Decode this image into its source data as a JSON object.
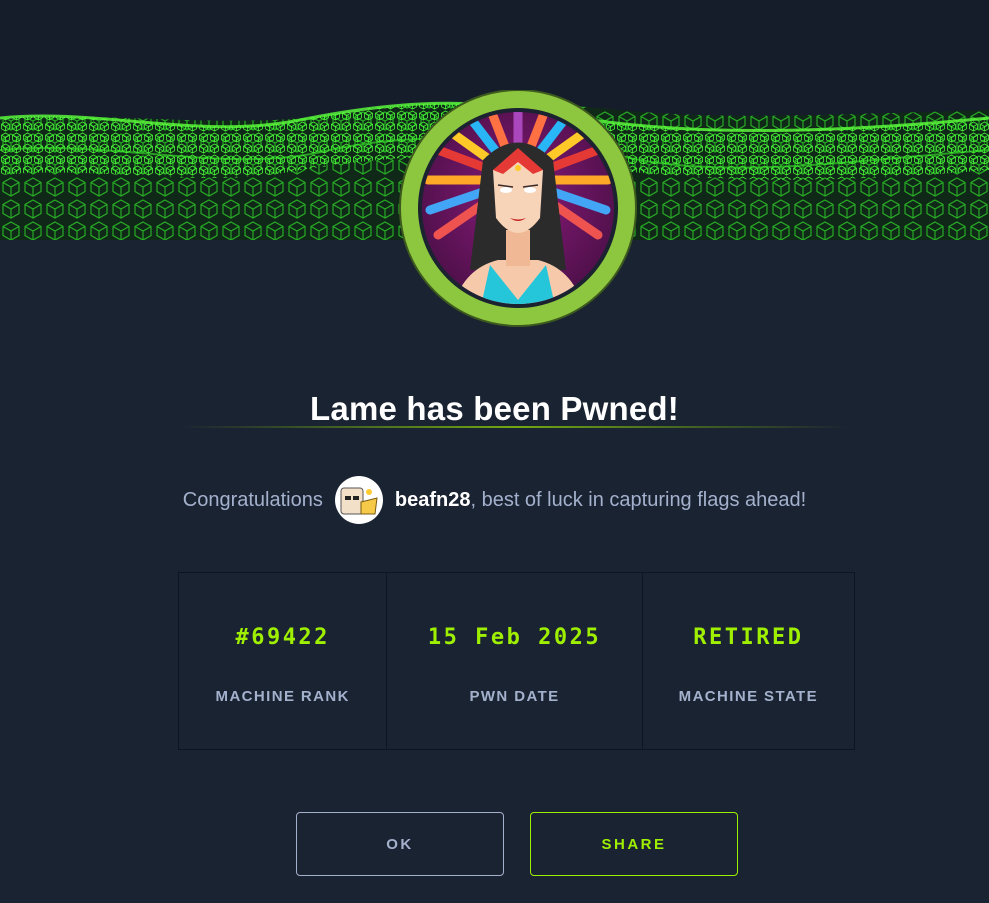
{
  "modal": {
    "title": "Lame has been Pwned!",
    "congrats_prefix": "Congratulations",
    "username": "beafn28",
    "congrats_suffix": ", best of luck in capturing flags ahead!"
  },
  "stats": [
    {
      "value": "#69422",
      "label": "MACHINE RANK"
    },
    {
      "value": "15 Feb 2025",
      "label": "PWN DATE"
    },
    {
      "value": "RETIRED",
      "label": "MACHINE STATE"
    }
  ],
  "buttons": {
    "ok_label": "OK",
    "share_label": "SHARE"
  },
  "icons": {
    "machine_avatar": "machine-avatar-icon",
    "user_avatar": "user-avatar-icon"
  },
  "colors": {
    "background": "#1a2332",
    "accent": "#9fef00",
    "muted": "#a4b1cd",
    "ring": "#8dc63f"
  }
}
